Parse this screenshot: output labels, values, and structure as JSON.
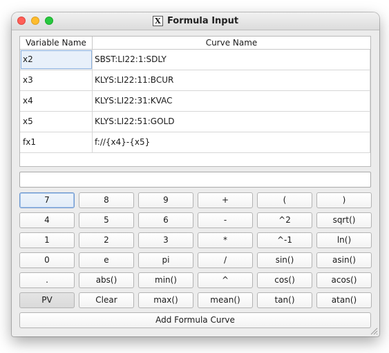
{
  "window": {
    "title": "Formula Input",
    "title_icon": "X"
  },
  "table": {
    "headers": {
      "variable": "Variable Name",
      "curve": "Curve Name"
    },
    "rows": [
      {
        "variable": "x2",
        "curve": "SBST:LI22:1:SDLY"
      },
      {
        "variable": "x3",
        "curve": "KLYS:LI22:11:BCUR"
      },
      {
        "variable": "x4",
        "curve": "KLYS:LI22:31:KVAC"
      },
      {
        "variable": "x5",
        "curve": "KLYS:LI22:51:GOLD"
      },
      {
        "variable": "fx1",
        "curve": "f://{x4}-{x5}"
      }
    ]
  },
  "formula": {
    "value": "",
    "placeholder": ""
  },
  "keypad": [
    [
      "7",
      "8",
      "9",
      "+",
      "(",
      ")"
    ],
    [
      "4",
      "5",
      "6",
      "-",
      "^2",
      "sqrt()"
    ],
    [
      "1",
      "2",
      "3",
      "*",
      "^-1",
      "ln()"
    ],
    [
      "0",
      "e",
      "pi",
      "/",
      "sin()",
      "asin()"
    ],
    [
      ".",
      "abs()",
      "min()",
      "^",
      "cos()",
      "acos()"
    ],
    [
      "PV",
      "Clear",
      "max()",
      "mean()",
      "tan()",
      "atan()"
    ]
  ],
  "add_button": "Add Formula Curve"
}
